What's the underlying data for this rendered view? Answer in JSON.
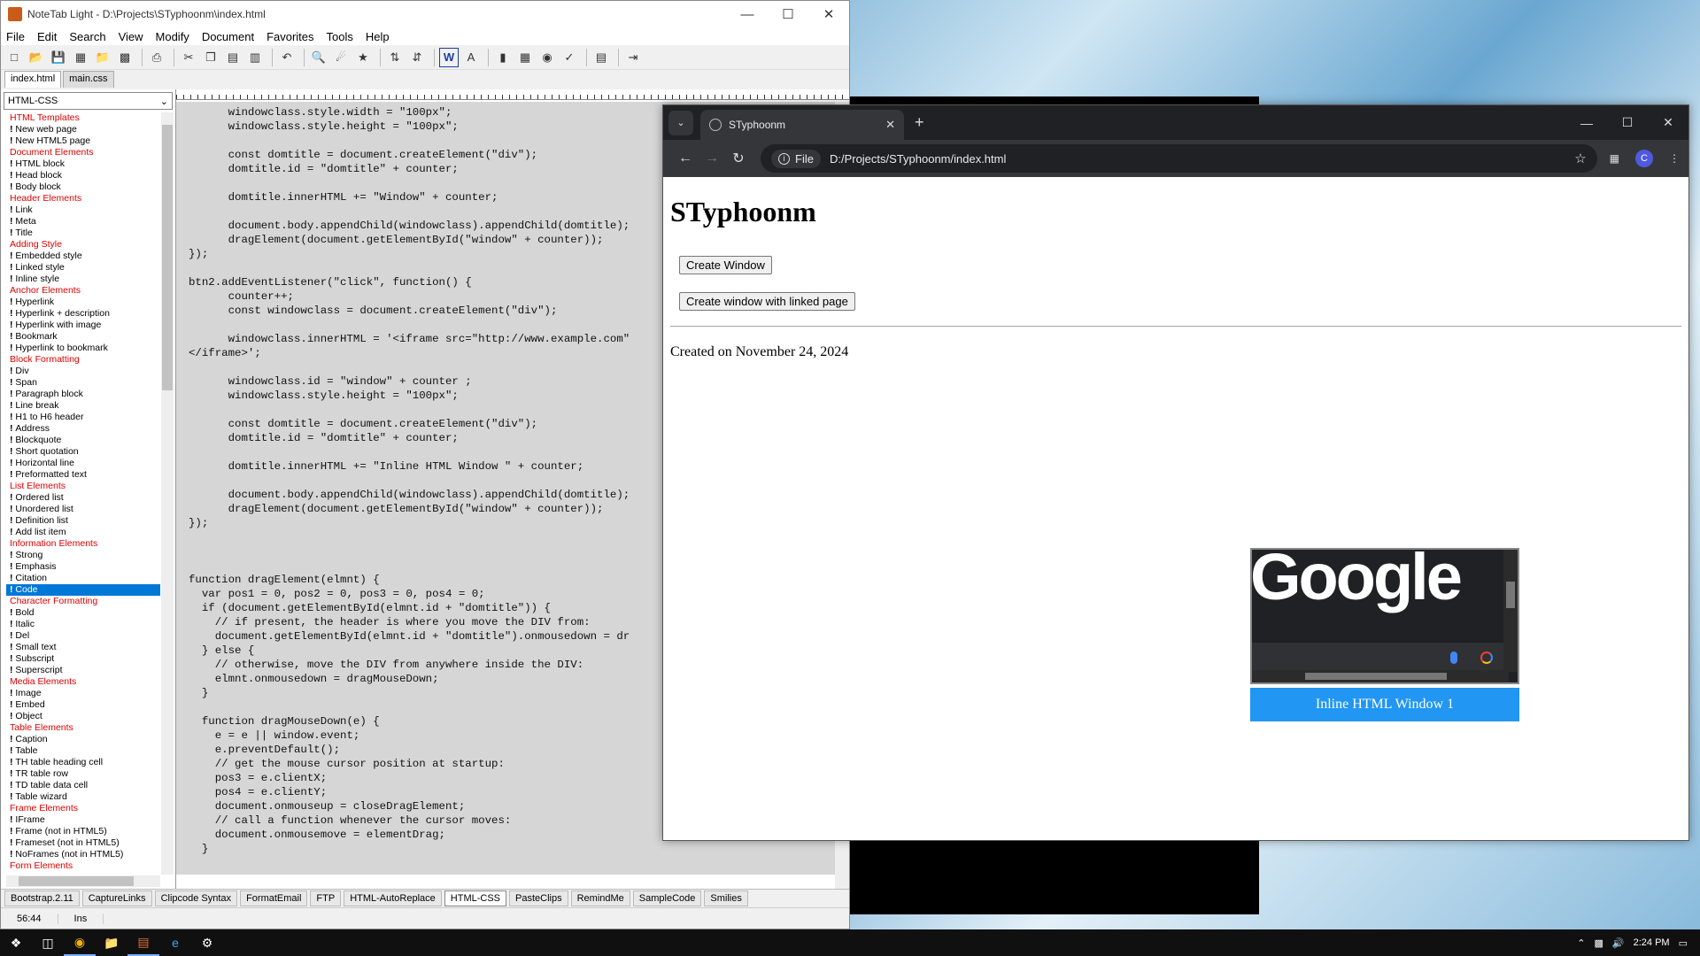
{
  "notetab": {
    "title": "NoteTab Light  -  D:\\Projects\\STyphoonm\\index.html",
    "menu": [
      "File",
      "Edit",
      "Search",
      "View",
      "Modify",
      "Document",
      "Favorites",
      "Tools",
      "Help"
    ],
    "doc_tabs": [
      "index.html",
      "main.css"
    ],
    "library_select": "HTML-CSS",
    "clip_list": [
      {
        "t": "cat",
        "label": "HTML Templates"
      },
      {
        "t": "item",
        "label": "New web page"
      },
      {
        "t": "item",
        "label": "New HTML5 page"
      },
      {
        "t": "cat",
        "label": "Document Elements"
      },
      {
        "t": "item",
        "label": "HTML block"
      },
      {
        "t": "item",
        "label": "Head block"
      },
      {
        "t": "item",
        "label": "Body block"
      },
      {
        "t": "cat",
        "label": "Header Elements"
      },
      {
        "t": "item",
        "label": "Link"
      },
      {
        "t": "item",
        "label": "Meta"
      },
      {
        "t": "item",
        "label": "Title"
      },
      {
        "t": "cat",
        "label": "Adding Style"
      },
      {
        "t": "item",
        "label": "Embedded style"
      },
      {
        "t": "item",
        "label": "Linked style"
      },
      {
        "t": "item",
        "label": "Inline style"
      },
      {
        "t": "cat",
        "label": "Anchor Elements"
      },
      {
        "t": "item",
        "label": "Hyperlink"
      },
      {
        "t": "item",
        "label": "Hyperlink + description"
      },
      {
        "t": "item",
        "label": "Hyperlink with image"
      },
      {
        "t": "item",
        "label": "Bookmark"
      },
      {
        "t": "item",
        "label": "Hyperlink to bookmark"
      },
      {
        "t": "cat",
        "label": "Block Formatting"
      },
      {
        "t": "item",
        "label": "Div"
      },
      {
        "t": "item",
        "label": "Span"
      },
      {
        "t": "item",
        "label": "Paragraph block"
      },
      {
        "t": "item",
        "label": "Line break"
      },
      {
        "t": "item",
        "label": "H1 to H6 header"
      },
      {
        "t": "item",
        "label": "Address"
      },
      {
        "t": "item",
        "label": "Blockquote"
      },
      {
        "t": "item",
        "label": "Short quotation"
      },
      {
        "t": "item",
        "label": "Horizontal line"
      },
      {
        "t": "item",
        "label": "Preformatted text"
      },
      {
        "t": "cat",
        "label": "List Elements"
      },
      {
        "t": "item",
        "label": "Ordered list"
      },
      {
        "t": "item",
        "label": "Unordered list"
      },
      {
        "t": "item",
        "label": "Definition list"
      },
      {
        "t": "item",
        "label": "Add list item"
      },
      {
        "t": "cat",
        "label": "Information Elements"
      },
      {
        "t": "item",
        "label": "Strong"
      },
      {
        "t": "item",
        "label": "Emphasis"
      },
      {
        "t": "item",
        "label": "Citation"
      },
      {
        "t": "item",
        "label": "Code",
        "selected": true
      },
      {
        "t": "cat",
        "label": "Character Formatting"
      },
      {
        "t": "item",
        "label": "Bold"
      },
      {
        "t": "item",
        "label": "Italic"
      },
      {
        "t": "item",
        "label": "Del"
      },
      {
        "t": "item",
        "label": "Small text"
      },
      {
        "t": "item",
        "label": "Subscript"
      },
      {
        "t": "item",
        "label": "Superscript"
      },
      {
        "t": "cat",
        "label": "Media Elements"
      },
      {
        "t": "item",
        "label": "Image"
      },
      {
        "t": "item",
        "label": "Embed"
      },
      {
        "t": "item",
        "label": "Object"
      },
      {
        "t": "cat",
        "label": "Table Elements"
      },
      {
        "t": "item",
        "label": "Caption"
      },
      {
        "t": "item",
        "label": "Table"
      },
      {
        "t": "item",
        "label": "TH table heading cell"
      },
      {
        "t": "item",
        "label": "TR table row"
      },
      {
        "t": "item",
        "label": "TD table data cell"
      },
      {
        "t": "item",
        "label": "Table wizard"
      },
      {
        "t": "cat",
        "label": "Frame Elements"
      },
      {
        "t": "item",
        "label": "IFrame"
      },
      {
        "t": "item",
        "label": "Frame (not in HTML5)"
      },
      {
        "t": "item",
        "label": "Frameset (not in HTML5)"
      },
      {
        "t": "item",
        "label": "NoFrames (not in HTML5)"
      },
      {
        "t": "cat",
        "label": "Form Elements"
      }
    ],
    "code": "      windowclass.style.width = \"100px\";\n      windowclass.style.height = \"100px\";\n\n      const domtitle = document.createElement(\"div\");\n      domtitle.id = \"domtitle\" + counter;\n\n      domtitle.innerHTML += \"Window\" + counter;\n\n      document.body.appendChild(windowclass).appendChild(domtitle);\n      dragElement(document.getElementById(\"window\" + counter));\n});\n\nbtn2.addEventListener(\"click\", function() {\n      counter++;\n      const windowclass = document.createElement(\"div\");\n\n      windowclass.innerHTML = '<iframe src=\"http://www.example.com\"\n</iframe>';\n\n      windowclass.id = \"window\" + counter ;\n      windowclass.style.height = \"100px\";\n\n      const domtitle = document.createElement(\"div\");\n      domtitle.id = \"domtitle\" + counter;\n\n      domtitle.innerHTML += \"Inline HTML Window \" + counter;\n\n      document.body.appendChild(windowclass).appendChild(domtitle);\n      dragElement(document.getElementById(\"window\" + counter));\n});\n\n\n\nfunction dragElement(elmnt) {\n  var pos1 = 0, pos2 = 0, pos3 = 0, pos4 = 0;\n  if (document.getElementById(elmnt.id + \"domtitle\")) {\n    // if present, the header is where you move the DIV from:\n    document.getElementById(elmnt.id + \"domtitle\").onmousedown = dr\n  } else {\n    // otherwise, move the DIV from anywhere inside the DIV:\n    elmnt.onmousedown = dragMouseDown;\n  }\n\n  function dragMouseDown(e) {\n    e = e || window.event;\n    e.preventDefault();\n    // get the mouse cursor position at startup:\n    pos3 = e.clientX;\n    pos4 = e.clientY;\n    document.onmouseup = closeDragElement;\n    // call a function whenever the cursor moves:\n    document.onmousemove = elementDrag;\n  }",
    "clip_tabs": [
      "Bootstrap.2.11",
      "CaptureLinks",
      "Clipcode Syntax",
      "FormatEmail",
      "FTP",
      "HTML-AutoReplace",
      "HTML-CSS",
      "PasteClips",
      "RemindMe",
      "SampleCode",
      "Smilies"
    ],
    "active_clip_tab": "HTML-CSS",
    "status_pos": "56:44",
    "status_mode": "Ins"
  },
  "chrome": {
    "tab_title": "STyphoonm",
    "url_chip": "File",
    "url": "D:/Projects/STyphoonm/index.html",
    "avatar_letter": "C",
    "page": {
      "heading": "STyphoonm",
      "btn_create": "Create Window",
      "btn_linked": "Create window with linked page",
      "created": "Created on November 24, 2024",
      "iframe_logo": "Google",
      "iframe_title": "Inline HTML Window 1"
    }
  },
  "taskbar": {
    "time": "2:24 PM"
  },
  "colors": {
    "category_red": "#e00000",
    "selection_blue": "#0078d7",
    "window_title_blue": "#2196f3"
  }
}
